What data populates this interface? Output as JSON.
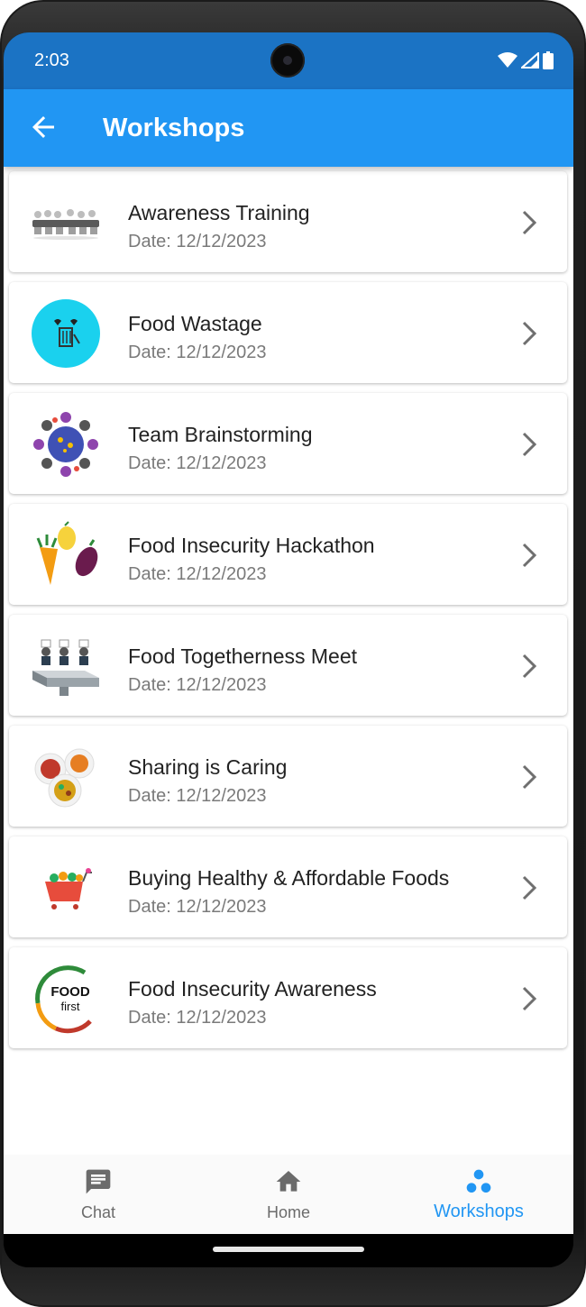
{
  "status": {
    "time": "2:03"
  },
  "appbar": {
    "title": "Workshops"
  },
  "workshops": [
    {
      "title": "Awareness Training",
      "date": "Date: 12/12/2023"
    },
    {
      "title": "Food Wastage",
      "date": "Date: 12/12/2023"
    },
    {
      "title": "Team Brainstorming",
      "date": "Date: 12/12/2023"
    },
    {
      "title": "Food Insecurity Hackathon",
      "date": "Date: 12/12/2023"
    },
    {
      "title": "Food Togetherness Meet",
      "date": "Date: 12/12/2023"
    },
    {
      "title": "Sharing is Caring",
      "date": "Date: 12/12/2023"
    },
    {
      "title": "Buying Healthy & Affordable Foods",
      "date": "Date: 12/12/2023"
    },
    {
      "title": "Food Insecurity Awareness",
      "date": "Date: 12/12/2023"
    }
  ],
  "thumbs": {
    "food_first_1": "FOOD",
    "food_first_2": "first"
  },
  "bottom_nav": {
    "chat": "Chat",
    "home": "Home",
    "workshops": "Workshops"
  },
  "colors": {
    "accent": "#2196f3",
    "status_bar": "#1b73c4",
    "title_text": "#222222",
    "date_text": "#7a7a7a"
  },
  "icons": [
    "back-arrow-icon",
    "chevron-right-icon",
    "chat-icon",
    "home-icon",
    "workshops-icon",
    "wifi-icon",
    "signal-icon",
    "battery-icon"
  ]
}
